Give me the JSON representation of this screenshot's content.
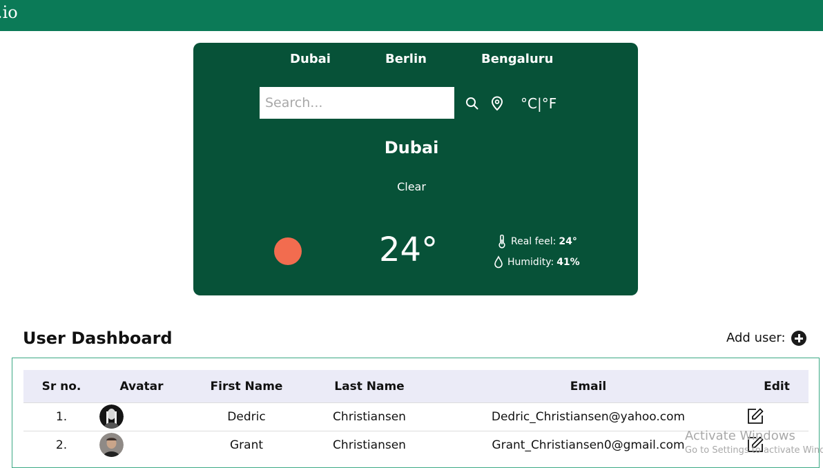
{
  "app": {
    "brand": ".io"
  },
  "weather": {
    "city_tabs": [
      "Dubai",
      "Berlin",
      "Bengaluru"
    ],
    "search_placeholder": "Search...",
    "unit_celsius": "°C",
    "unit_separator": "|",
    "unit_fahrenheit": "°F",
    "city": "Dubai",
    "condition": "Clear",
    "temperature": "24°",
    "real_feel_label": "Real feel:",
    "real_feel_value": "24°",
    "humidity_label": "Humidity:",
    "humidity_value": "41%",
    "sun_color": "#f26c4f"
  },
  "dashboard": {
    "title": "User Dashboard",
    "add_user_label": "Add user:",
    "columns": [
      "Sr no.",
      "Avatar",
      "First Name",
      "Last Name",
      "Email",
      "Edit"
    ],
    "rows": [
      {
        "sr": "1.",
        "first": "Dedric",
        "last": "Christiansen",
        "email": "Dedric_Christiansen@yahoo.com"
      },
      {
        "sr": "2.",
        "first": "Grant",
        "last": "Christiansen",
        "email": "Grant_Christiansen0@gmail.com"
      }
    ]
  },
  "os_watermark": {
    "line1": "Activate Windows",
    "line2": "Go to Settings to activate Windows."
  },
  "colors": {
    "header_bar": "#0b7a57",
    "weather_card": "#075238",
    "table_header": "#ebebf7"
  }
}
